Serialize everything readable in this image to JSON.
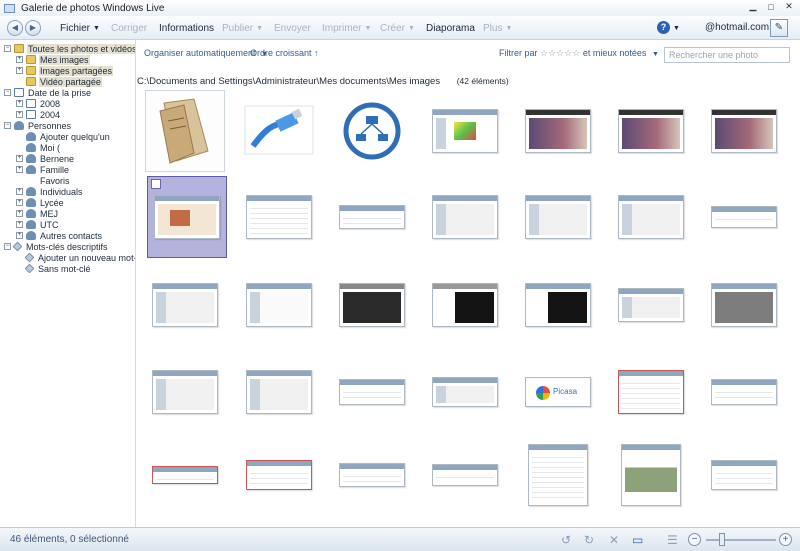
{
  "window": {
    "title": "Galerie de photos Windows Live",
    "controls": [
      "minimize-icon",
      "maximize-icon",
      "close-icon"
    ]
  },
  "toolbar": {
    "back_icon": "back-arrow-icon",
    "forward_icon": "forward-arrow-icon",
    "menus": [
      {
        "label": "Fichier",
        "enabled": true,
        "dropdown": true
      },
      {
        "label": "Corriger",
        "enabled": false,
        "dropdown": false
      },
      {
        "label": "Informations",
        "enabled": true,
        "dropdown": false
      },
      {
        "label": "Publier",
        "enabled": false,
        "dropdown": true
      },
      {
        "label": "Envoyer",
        "enabled": false,
        "dropdown": false
      },
      {
        "label": "Imprimer",
        "enabled": false,
        "dropdown": true
      },
      {
        "label": "Créer",
        "enabled": false,
        "dropdown": true
      },
      {
        "label": "Diaporama",
        "enabled": true,
        "dropdown": false
      },
      {
        "label": "Plus",
        "enabled": false,
        "dropdown": true
      }
    ],
    "account": "@hotmail.com",
    "help_icon": "help-icon",
    "edit_icon": "pen-icon"
  },
  "sidebar": {
    "items": [
      {
        "label": "Toutes les photos et vidéos",
        "expander": "⊟",
        "icon": "folder",
        "selected": true
      },
      {
        "label": "Mes images",
        "expander": "⊞",
        "icon": "folder",
        "selected": true
      },
      {
        "label": "Images partagées",
        "expander": "⊞",
        "icon": "folder",
        "selected": true
      },
      {
        "label": "Vidéo partagée",
        "expander": "",
        "icon": "folder",
        "selected": true
      },
      {
        "label": "Date de la prise",
        "expander": "⊟",
        "icon": "cal",
        "selected": false
      },
      {
        "label": "2008",
        "expander": "⊞",
        "icon": "cal",
        "selected": false
      },
      {
        "label": "2004",
        "expander": "⊞",
        "icon": "cal",
        "selected": false
      },
      {
        "label": "Personnes",
        "expander": "⊟",
        "icon": "person",
        "selected": false
      },
      {
        "label": "Ajouter quelqu'un",
        "expander": "",
        "icon": "person",
        "selected": false
      },
      {
        "label": "Moi (",
        "expander": "",
        "icon": "person",
        "selected": false
      },
      {
        "label": "Bernene",
        "expander": "⊞",
        "icon": "person",
        "selected": false
      },
      {
        "label": "Famille",
        "expander": "⊞",
        "icon": "person",
        "selected": false
      },
      {
        "label": "Favoris",
        "expander": "",
        "icon": "person",
        "selected": false
      },
      {
        "label": "Individuals",
        "expander": "⊞",
        "icon": "person",
        "selected": false
      },
      {
        "label": "Lycée",
        "expander": "⊞",
        "icon": "person",
        "selected": false
      },
      {
        "label": "MEJ",
        "expander": "⊞",
        "icon": "person",
        "selected": false
      },
      {
        "label": "UTC",
        "expander": "⊞",
        "icon": "person",
        "selected": false
      },
      {
        "label": "Autres contacts",
        "expander": "⊞",
        "icon": "person",
        "selected": false
      },
      {
        "label": "Mots-clés descriptifs",
        "expander": "⊟",
        "icon": "tag",
        "selected": false
      },
      {
        "label": "Ajouter un nouveau mot-clé",
        "expander": "",
        "icon": "tag",
        "selected": false
      },
      {
        "label": "Sans mot-clé",
        "expander": "",
        "icon": "tag",
        "selected": false
      }
    ]
  },
  "content": {
    "organize_label": "Organiser automatiquement",
    "sort_label": "Ordre croissant",
    "filter_label": "Filtrer par",
    "filter_suffix": "et mieux notées",
    "filter_stars": "☆☆☆☆☆",
    "search_placeholder": "Rechercher une photo",
    "path": "C:\\Documents and Settings\\Administrateur\\Mes documents\\Mes images",
    "count": "(42 éléments)",
    "thumbnails": [
      "document-photo",
      "network-cable-photo",
      "network-diagram",
      "acid3-screenshot",
      "desktop-screenshot",
      "desktop-screenshot",
      "desktop-screenshot",
      "window-screenshot",
      "window-screenshot",
      "window-screenshot",
      "window-screenshot",
      "window-screenshot",
      "window-screenshot",
      "window-screenshot",
      "window-screenshot",
      "window-screenshot",
      "dark-screenshot",
      "dark-screenshot",
      "window-screenshot",
      "window-screenshot",
      "window-screenshot",
      "window-screenshot",
      "window-screenshot",
      "window-screenshot",
      "window-screenshot",
      "picasa-screenshot",
      "window-screenshot",
      "window-screenshot",
      "window-screenshot",
      "window-screenshot",
      "window-screenshot",
      "window-screenshot",
      "window-screenshot",
      "window-screenshot",
      "window-screenshot"
    ],
    "picasa_text": "Picasa"
  },
  "status": {
    "text": "46 éléments, 0 sélectionné"
  }
}
